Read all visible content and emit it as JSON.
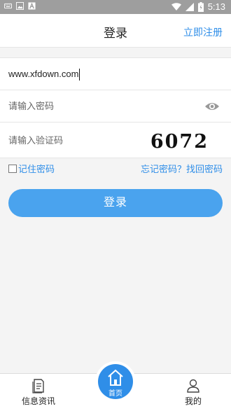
{
  "status_bar": {
    "time": "5:13",
    "icons": [
      "keyboard-icon",
      "image-icon",
      "text-icon",
      "wifi-icon",
      "signal-icon",
      "battery-icon"
    ]
  },
  "header": {
    "title": "登录",
    "register_label": "立即注册"
  },
  "form": {
    "username_value": "www.xfdown.com",
    "password_placeholder": "请输入密码",
    "captcha_placeholder": "请输入验证码",
    "captcha_code": "6072"
  },
  "options": {
    "remember_label": "记住密码",
    "forgot_label": "忘记密码？找回密码"
  },
  "login_button_label": "登录",
  "tabbar": {
    "news_label": "信息资讯",
    "home_label": "首页",
    "mine_label": "我的"
  },
  "colors": {
    "accent": "#2f8ee8",
    "button": "#4aa3ee",
    "status_bar": "#9e9e9e"
  }
}
